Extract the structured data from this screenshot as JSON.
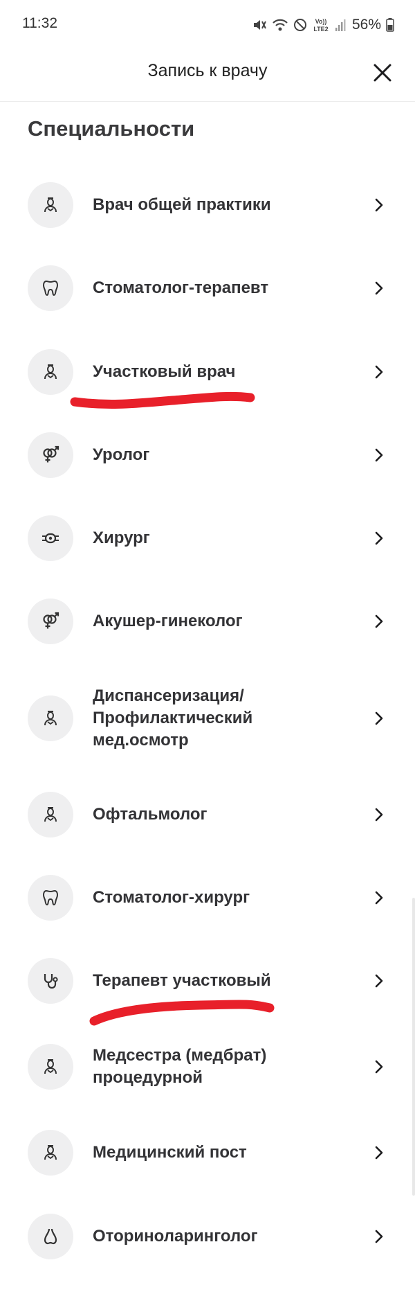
{
  "status_bar": {
    "time": "11:32",
    "battery": "56%",
    "icons": [
      "mute-icon",
      "wifi-calling-icon",
      "do-not-disturb-icon",
      "volte-lte2-icon",
      "signal-icon",
      "battery-icon"
    ],
    "volte_text": "Vo))",
    "lte_text": "LTE2"
  },
  "header": {
    "title": "Запись к врачу",
    "close_icon": "close-icon"
  },
  "section_title": "Специальности",
  "specialties": [
    {
      "label": "Врач общей практики",
      "icon": "doctor-icon"
    },
    {
      "label": "Стоматолог-терапевт",
      "icon": "tooth-icon"
    },
    {
      "label": "Участковый врач",
      "icon": "doctor-icon"
    },
    {
      "label": "Уролог",
      "icon": "gender-icon"
    },
    {
      "label": "Хирург",
      "icon": "bandage-icon"
    },
    {
      "label": "Акушер-гинеколог",
      "icon": "gender-icon"
    },
    {
      "label": "Диспансеризация/ Профилактический мед.осмотр",
      "icon": "doctor-icon"
    },
    {
      "label": "Офтальмолог",
      "icon": "doctor-icon"
    },
    {
      "label": "Стоматолог-хирург",
      "icon": "tooth-icon"
    },
    {
      "label": "Терапевт участковый",
      "icon": "stethoscope-icon"
    },
    {
      "label": "Медсестра (медбрат) процедурной",
      "icon": "doctor-icon"
    },
    {
      "label": "Медицинский пост",
      "icon": "doctor-icon"
    },
    {
      "label": "Оториноларинголог",
      "icon": "nose-icon"
    }
  ],
  "colors": {
    "background": "#ffffff",
    "icon_circle": "#efeff0",
    "text": "#333336",
    "annotation_red": "#e8202a"
  }
}
